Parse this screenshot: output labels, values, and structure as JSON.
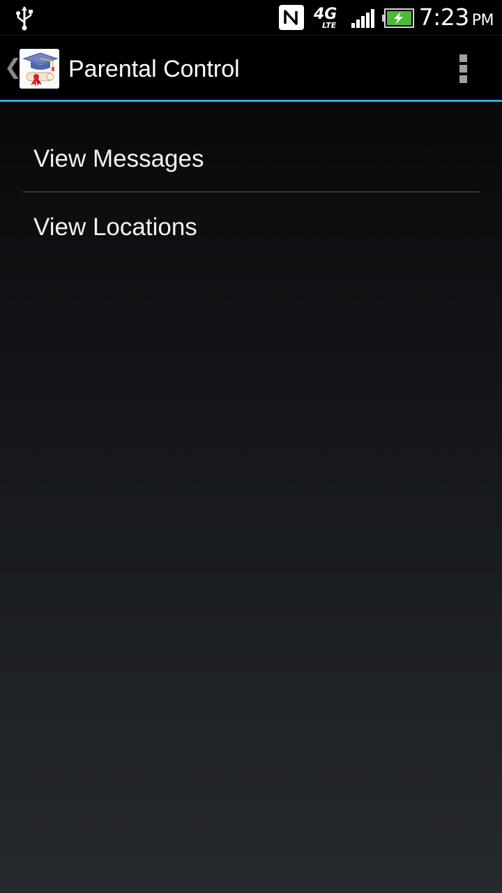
{
  "status_bar": {
    "time": "7:23",
    "ampm": "PM",
    "network_label": "4G",
    "network_sub": "LTE",
    "icons": [
      "usb-icon",
      "nfc-icon",
      "lte-icon",
      "signal-icon",
      "battery-charging-icon"
    ]
  },
  "action_bar": {
    "title": "Parental Control",
    "icon": "graduation-cap-diploma-icon",
    "accent_color": "#33a9dc"
  },
  "menu": {
    "items": [
      {
        "label": "View Messages"
      },
      {
        "label": "View Locations"
      }
    ]
  }
}
